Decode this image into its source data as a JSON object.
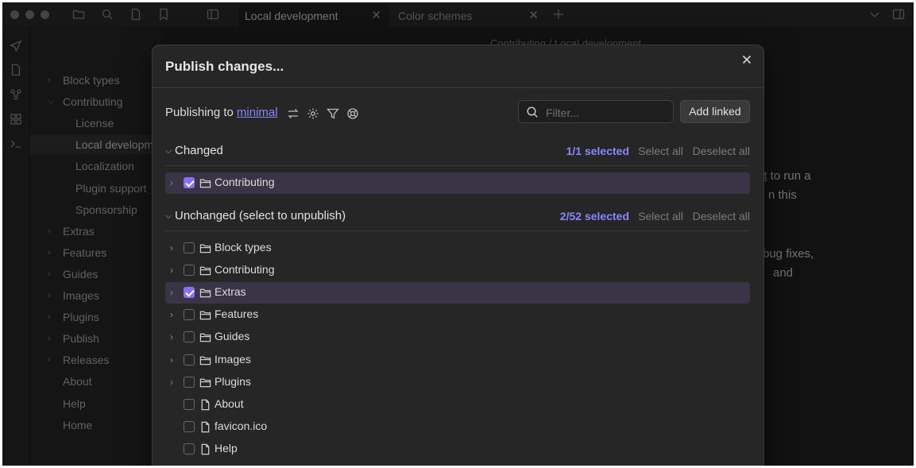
{
  "window": {
    "tabs": [
      {
        "label": "Local development"
      },
      {
        "label": "Color schemes"
      }
    ]
  },
  "sidebar": {
    "items": [
      {
        "label": "Block types",
        "expandable": true
      },
      {
        "label": "Contributing",
        "expandable": true
      },
      {
        "label": "License",
        "expandable": false
      },
      {
        "label": "Local development",
        "expandable": false,
        "active": true
      },
      {
        "label": "Localization",
        "expandable": false
      },
      {
        "label": "Plugin support",
        "expandable": false
      },
      {
        "label": "Sponsorship",
        "expandable": false
      },
      {
        "label": "Extras",
        "expandable": true
      },
      {
        "label": "Features",
        "expandable": true
      },
      {
        "label": "Guides",
        "expandable": true
      },
      {
        "label": "Images",
        "expandable": true
      },
      {
        "label": "Plugins",
        "expandable": true
      },
      {
        "label": "Publish",
        "expandable": true
      },
      {
        "label": "Releases",
        "expandable": true
      },
      {
        "label": "About",
        "expandable": false
      },
      {
        "label": "Help",
        "expandable": false
      },
      {
        "label": "Home",
        "expandable": false
      }
    ]
  },
  "content": {
    "breadcrumb": "Contributing / Local development",
    "fragments": [
      {
        "link": "nt",
        "text": " to run a"
      },
      {
        "text": "n this"
      },
      {
        "text": "bug fixes,"
      },
      {
        "text": " and"
      }
    ]
  },
  "modal": {
    "title": "Publish changes...",
    "publishing_to_label": "Publishing to",
    "site_name": "minimal",
    "filter_placeholder": "Filter...",
    "add_linked_label": "Add linked",
    "changed": {
      "label": "Changed",
      "selected_count": "1/1 selected",
      "select_all": "Select all",
      "deselect_all": "Deselect all",
      "items": [
        {
          "name": "Contributing",
          "type": "folder",
          "checked": true
        }
      ]
    },
    "unchanged": {
      "label": "Unchanged (select to unpublish)",
      "selected_count": "2/52 selected",
      "select_all": "Select all",
      "deselect_all": "Deselect all",
      "items": [
        {
          "name": "Block types",
          "type": "folder",
          "checked": false
        },
        {
          "name": "Contributing",
          "type": "folder",
          "checked": false
        },
        {
          "name": "Extras",
          "type": "folder",
          "checked": true
        },
        {
          "name": "Features",
          "type": "folder",
          "checked": false
        },
        {
          "name": "Guides",
          "type": "folder",
          "checked": false
        },
        {
          "name": "Images",
          "type": "folder",
          "checked": false
        },
        {
          "name": "Plugins",
          "type": "folder",
          "checked": false
        },
        {
          "name": "About",
          "type": "file",
          "checked": false
        },
        {
          "name": "favicon.ico",
          "type": "file",
          "checked": false
        },
        {
          "name": "Help",
          "type": "file",
          "checked": false
        }
      ]
    }
  },
  "colors": {
    "accent": "#8a86ff",
    "checkbox_checked": "#8a70f0",
    "selected_row": "#3a3546"
  }
}
